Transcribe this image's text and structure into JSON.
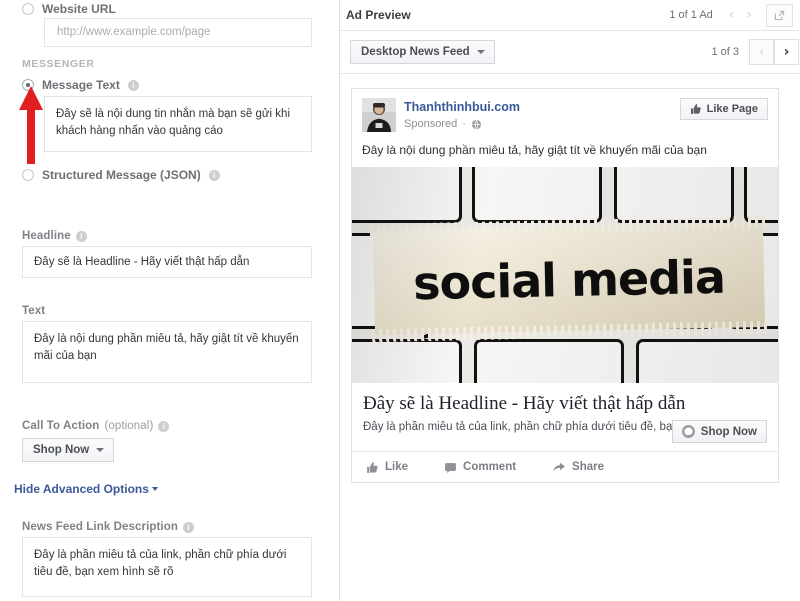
{
  "form": {
    "website_url": {
      "label": "Website URL",
      "radio_selected": false,
      "placeholder": "http://www.example.com/page",
      "value": ""
    },
    "messenger_section_title": "MESSENGER",
    "message_text": {
      "label": "Message Text",
      "radio_selected": true,
      "info_icon": "info-icon",
      "value": "Đây sẽ là nội dung tin nhắn mà bạn sẽ gửi khi khách hàng nhấn vào quảng cáo"
    },
    "structured_message": {
      "label": "Structured Message (JSON)",
      "radio_selected": false,
      "info_icon": "info-icon"
    },
    "headline": {
      "label": "Headline",
      "info_icon": "info-icon",
      "value": "Đây sẽ là Headline - Hãy viết thật hấp dẫn"
    },
    "text": {
      "label": "Text",
      "value": "Đây là nội dung phần miêu tả, hãy giật tít về khuyến mãi của bạn"
    },
    "call_to_action": {
      "label": "Call To Action",
      "optional_suffix": "(optional)",
      "info_icon": "info-icon",
      "selected": "Shop Now",
      "caret_icon": "chevron-down-icon"
    },
    "advanced_options_link": "Hide Advanced Options",
    "news_feed_link_description": {
      "label": "News Feed Link Description",
      "info_icon": "info-icon",
      "value": "Đây là phần miêu tả của link, phần chữ phía dưới tiêu đề, bạn xem hình sẽ rõ"
    },
    "annotation_arrow": {
      "icon": "red-arrow-up-icon",
      "color": "#e02020",
      "points_to": "Message Text"
    }
  },
  "preview": {
    "title": "Ad Preview",
    "ad_count": "1 of 1 Ad",
    "prev_icon": "chevron-left-icon",
    "next_icon": "chevron-right-icon",
    "popout_icon": "external-link-icon",
    "placement": {
      "label": "Desktop News Feed",
      "caret_icon": "chevron-down-icon"
    },
    "placement_count": "1 of 3",
    "placement_prev_icon": "chevron-left-icon",
    "placement_next_icon": "chevron-right-icon"
  },
  "ad": {
    "avatar": "page-profile-photo",
    "page_name": "Thanhthinhbui.com",
    "sponsored": "Sponsored",
    "dot": "·",
    "globe_icon": "globe-icon",
    "like_page": {
      "label": "Like Page",
      "icon": "thumbs-up-icon"
    },
    "body_text": "Đây là nội dung phần miêu tả, hãy giật tít về khuyến mãi của bạn",
    "image": {
      "name": "keyboard-social-media-photo",
      "overlay_word": "social media"
    },
    "headline": "Đây sẽ là Headline - Hãy viết thật hấp dẫn",
    "description": "Đây là phần miêu tả của link, phần chữ phía dưới tiêu đề, bạn xem hình sẽ rõ",
    "cta": {
      "label": "Shop Now",
      "icon": "messenger-icon"
    },
    "actions": [
      {
        "label": "Like",
        "icon": "thumbs-up-icon"
      },
      {
        "label": "Comment",
        "icon": "comment-icon"
      },
      {
        "label": "Share",
        "icon": "share-arrow-icon"
      }
    ]
  },
  "colors": {
    "link": "#3b5998",
    "annotation_red": "#e02020",
    "border": "#dfe1e5",
    "label_gray": "#7f8288"
  }
}
